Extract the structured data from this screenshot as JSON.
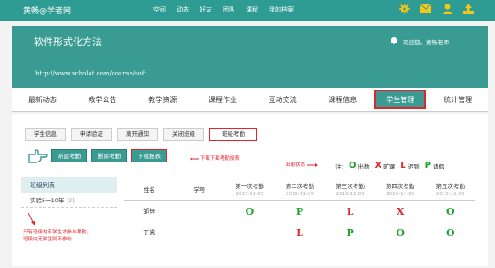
{
  "topbar": {
    "brand": "黄畅@学者网",
    "nav": [
      "空间",
      "动态",
      "好友",
      "团队",
      "课程",
      "我的档案"
    ],
    "icons": [
      "gear-icon",
      "mail-icon",
      "user-icon",
      "upload-icon"
    ]
  },
  "header": {
    "title": "软件形式化方法",
    "url": "http://www.scholat.com/course/soft",
    "welcome": "欢迎您，黄畅老师"
  },
  "mainnav": [
    "最新动态",
    "教学公告",
    "教学资源",
    "课程作业",
    "互动交流",
    "课程信息",
    "学生管理",
    "统计管理"
  ],
  "tabs": [
    "学生信息",
    "申请验证",
    "离开通知",
    "关闭班级",
    "班级考勤"
  ],
  "buttons": {
    "new": "新建考勤",
    "delete": "删除考勤",
    "download": "下载报表"
  },
  "annotations": {
    "download_note": "下载下面考勤报表",
    "status_note": "出勤状态",
    "sidebar_note_1": "只有班级内有学生才参与考勤，",
    "sidebar_note_2": "班级内无学生则不参与"
  },
  "legend": {
    "prefix": "注：",
    "items": [
      {
        "symbol": "O",
        "label": "出勤",
        "color": "#1da42a"
      },
      {
        "symbol": "X",
        "label": "旷课",
        "color": "#e0262d"
      },
      {
        "symbol": "L",
        "label": "迟到",
        "color": "#e0262d"
      },
      {
        "symbol": "P",
        "label": "请假",
        "color": "#1da42a"
      }
    ]
  },
  "sidebar": {
    "title": "班级列表",
    "item_name": "实验5一10年",
    "item_count": "[2]"
  },
  "table": {
    "headers": [
      "姓名",
      "学号"
    ],
    "sessions": [
      {
        "name": "第一次考勤",
        "date": "2015-11-05"
      },
      {
        "name": "第二次考勤",
        "date": "2015-11-05"
      },
      {
        "name": "第三次考勤",
        "date": "2015-11-05"
      },
      {
        "name": "第四次考勤",
        "date": "2015-11-05"
      },
      {
        "name": "第五次考勤",
        "date": "2015-11-05"
      }
    ],
    "rows": [
      {
        "name": "邹锋",
        "id": "",
        "marks": [
          "O",
          "P",
          "L",
          "X",
          "O"
        ]
      },
      {
        "name": "丁嵩",
        "id": "",
        "marks": [
          "",
          "L",
          "P",
          "O",
          "O"
        ]
      }
    ]
  }
}
